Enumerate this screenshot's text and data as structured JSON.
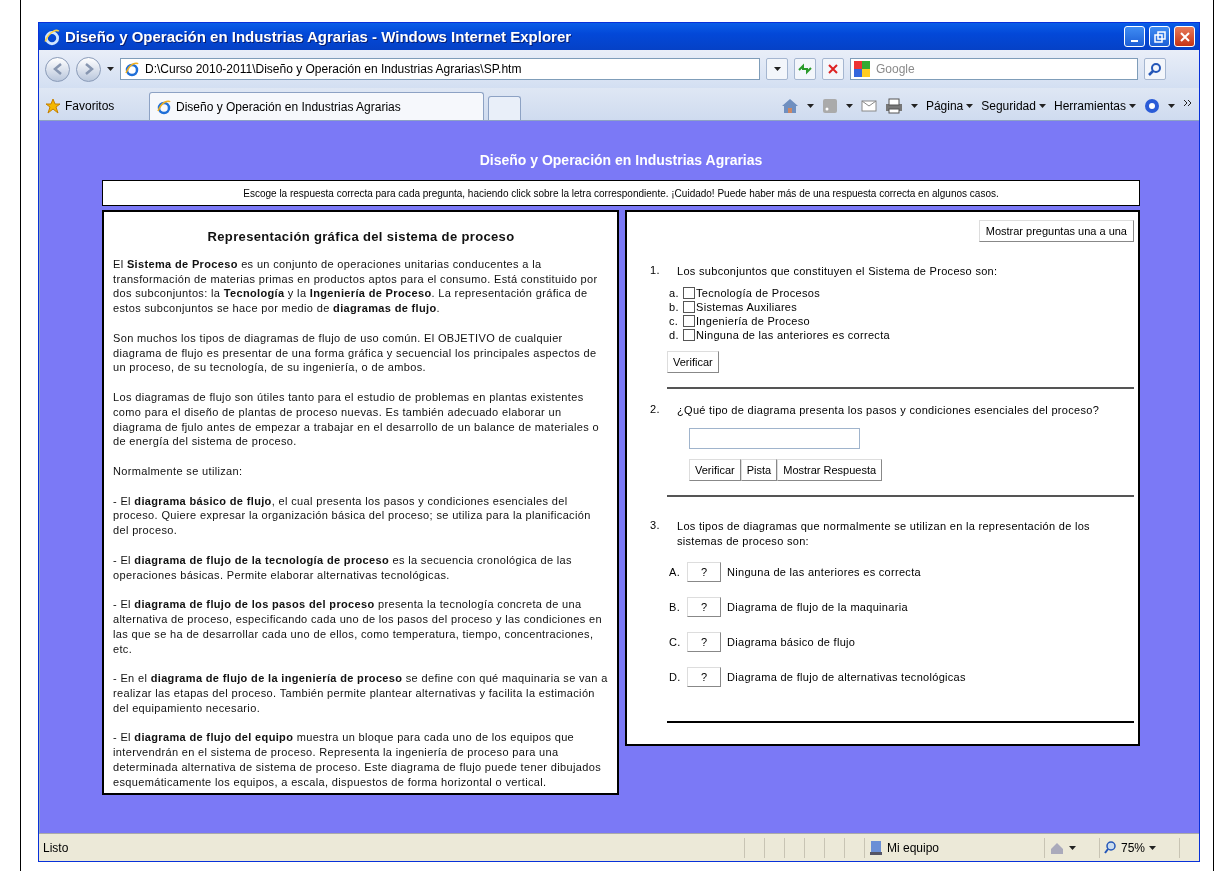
{
  "window": {
    "title": "Diseño y Operación en Industrias Agrarias - Windows Internet Explorer"
  },
  "address_bar": {
    "value": "D:\\Curso 2010-2011\\Diseño y Operación en Industrias Agrarias\\SP.htm"
  },
  "search": {
    "placeholder": "Google"
  },
  "favorites": {
    "label": "Favoritos"
  },
  "tabs": [
    {
      "label": "Diseño y Operación en Industrias Agrarias",
      "selected": true
    }
  ],
  "command_bar": [
    "Página",
    "Seguridad",
    "Herramientas"
  ],
  "page": {
    "title": "Diseño y Operación en Industrias Agrarias",
    "instructions": "Escoge la respuesta correcta para cada pregunta, haciendo click sobre la letra correspondiente. ¡Cuidado! Puede haber más de una respuesta correcta en algunos casos.",
    "article": {
      "heading": "Representación gráfica del sistema de proceso",
      "paragraphs": [
        "El **Sistema de Proceso** es un conjunto de operaciones unitarias conducentes a la transformación de materias primas en productos aptos para el consumo. Está constituido por dos subconjuntos: la **Tecnología** y la **Ingeniería de Proceso**. La representación gráfica de estos subconjuntos se hace por medio de **diagramas de flujo**.",
        "Son muchos los tipos de diagramas de flujo de uso común. El OBJETIVO de cualquier diagrama de flujo es presentar de una forma gráfica y secuencial los principales aspectos de un proceso, de su tecnología, de su ingeniería, o de ambos.",
        "Los diagramas de flujo son útiles tanto para el estudio de problemas en plantas existentes como para el diseño de plantas de proceso nuevas. Es también adecuado elaborar un diagrama de fjulo antes de empezar a trabajar en el desarrollo de un balance de materiales o de energía del sistema de proceso.",
        "Normalmente se utilizan:",
        "- El **diagrama básico de flujo**, el cual presenta los pasos y condiciones esenciales del proceso. Quiere expresar la organización básica del proceso; se utiliza para la planificación del proceso.",
        "- El **diagrama de flujo de la tecnología de proceso** es la secuencia cronológica de las operaciones básicas. Permite elaborar alternativas tecnológicas.",
        "- El **diagrama de flujo de los pasos del proceso** presenta la tecnología concreta de una alternativa de proceso, especificando cada uno de los pasos del proceso y las condiciones en las que se ha de desarrollar cada uno de ellos, como temperatura, tiempo, concentraciones, etc.",
        "- En el **diagrama de flujo de la ingeniería de proceso** se define con qué maquinaria se van a realizar las etapas del proceso. También permite plantear alternativas y facilita la estimación del equipamiento necesario.",
        "- El **diagrama de flujo del equipo** muestra un bloque para cada uno de los equipos que intervendrán en el sistema de proceso. Representa la ingeniería de proceso para una determinada alternativa de sistema de proceso. Este diagrama de flujo puede tener dibujados esquemáticamente los equipos, a escala, dispuestos de forma horizontal o vertical."
      ]
    },
    "quiz": {
      "mode_button": "Mostrar preguntas una a una",
      "questions": [
        {
          "kind": "checkbox",
          "number": "1.",
          "prompt": "Los subconjuntos que constituyen el Sistema de Proceso son:",
          "options": [
            {
              "letter": "a.",
              "label": "Tecnología de Procesos",
              "checked": false
            },
            {
              "letter": "b.",
              "label": "Sistemas Auxiliares",
              "checked": false
            },
            {
              "letter": "c.",
              "label": "Ingeniería de Proceso",
              "checked": false
            },
            {
              "letter": "d.",
              "label": "Ninguna de las anteriores es correcta",
              "checked": false
            }
          ],
          "buttons": [
            "Verificar"
          ]
        },
        {
          "kind": "text",
          "number": "2.",
          "prompt": "¿Qué tipo de diagrama presenta los pasos y condiciones esenciales del proceso?",
          "buttons": [
            "Verificar",
            "Pista",
            "Mostrar Respuesta"
          ]
        },
        {
          "kind": "match",
          "number": "3.",
          "prompt": "Los tipos de diagramas que normalmente se utilizan en la representación de los sistemas de proceso son:",
          "options": [
            {
              "letter": "A.",
              "button": "?",
              "label": "Ninguna de las anteriores es correcta"
            },
            {
              "letter": "B.",
              "button": "?",
              "label": "Diagrama de flujo de la maquinaria"
            },
            {
              "letter": "C.",
              "button": "?",
              "label": "Diagrama básico de flujo"
            },
            {
              "letter": "D.",
              "button": "?",
              "label": "Diagrama de flujo de alternativas tecnológicas"
            }
          ]
        }
      ]
    }
  },
  "status_bar": {
    "text": "Listo",
    "zone": "Mi equipo",
    "zoom": "75%"
  }
}
